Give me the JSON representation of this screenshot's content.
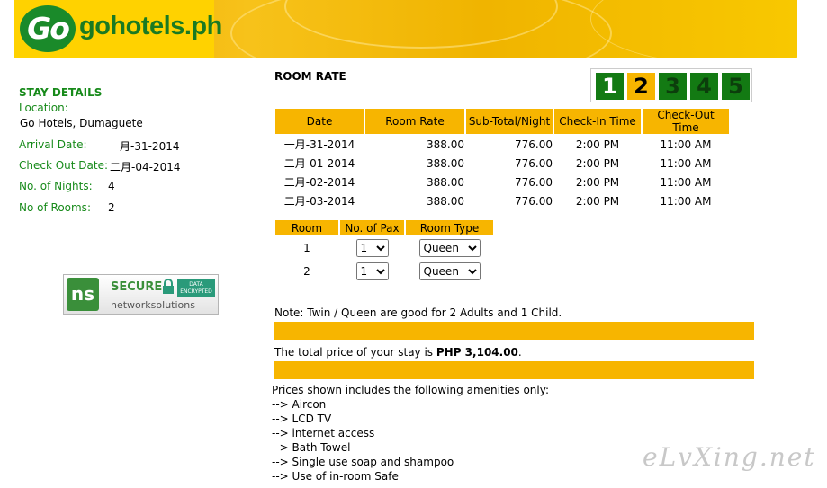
{
  "header": {
    "logo_mark": "Go",
    "logo_text": "gohotels.ph"
  },
  "sidebar": {
    "title": "STAY DETAILS",
    "location_label": "Location:",
    "location_value": "Go Hotels, Dumaguete",
    "arrival_label": "Arrival Date:",
    "arrival_value": "一月-31-2014",
    "checkout_label": "Check Out Date:",
    "checkout_value": "二月-04-2014",
    "nights_label": "No. of Nights:",
    "nights_value": "4",
    "rooms_label": "No of Rooms:",
    "rooms_value": "2"
  },
  "seal": {
    "logo": "ns",
    "secure": "SECURE",
    "encrypted": "DATA ENCRYPTED",
    "brand": "networksolutions"
  },
  "main": {
    "title": "ROOM RATE",
    "steps": [
      "1",
      "2",
      "3",
      "4",
      "5"
    ],
    "current_step": 2,
    "rates_headers": [
      "Date",
      "Room Rate",
      "Sub-Total/Night",
      "Check-In Time",
      "Check-Out Time"
    ],
    "rates_rows": [
      [
        "一月-31-2014",
        "388.00",
        "776.00",
        "2:00 PM",
        "11:00 AM"
      ],
      [
        "二月-01-2014",
        "388.00",
        "776.00",
        "2:00 PM",
        "11:00 AM"
      ],
      [
        "二月-02-2014",
        "388.00",
        "776.00",
        "2:00 PM",
        "11:00 AM"
      ],
      [
        "二月-03-2014",
        "388.00",
        "776.00",
        "2:00 PM",
        "11:00 AM"
      ]
    ],
    "rooms_headers": [
      "Room",
      "No. of Pax",
      "Room Type"
    ],
    "rooms_rows": [
      {
        "room": "1",
        "pax": "1",
        "type": "Queen"
      },
      {
        "room": "2",
        "pax": "1",
        "type": "Queen"
      }
    ],
    "note": "Note: Twin / Queen are good for 2 Adults and 1 Child.",
    "total_prefix": "The total price of your stay is ",
    "total_amount": "PHP 3,104.00",
    "total_suffix": ".",
    "amenities_intro": "Prices shown includes the following amenities only:",
    "amenities": [
      "--> Aircon",
      "--> LCD TV",
      "--> internet access",
      "--> Bath Towel",
      "--> Single use soap and shampoo",
      "--> Use of in-room Safe"
    ]
  },
  "watermark": "eLvXing.net",
  "colors": {
    "accent": "#f7b500",
    "green": "#178a1a",
    "step_green": "#137a13"
  }
}
